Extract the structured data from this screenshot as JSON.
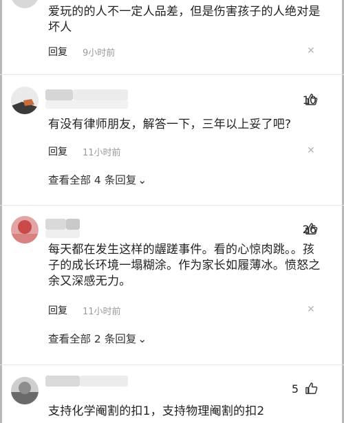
{
  "comments": [
    {
      "text_lines": [
        "爱玩的的人不一定人品差，但是伤害孩子的人绝对是",
        "坏人"
      ],
      "reply_label": "回复",
      "time": "9小时前"
    },
    {
      "likes": "10",
      "text_lines": [
        "有没有律师朋友，解答一下，三年以上妥了吧?"
      ],
      "reply_label": "回复",
      "time": "11小时前",
      "more_replies": "查看全部 4 条回复"
    },
    {
      "likes": "26",
      "text_lines": [
        "每天都在发生这样的龌蹉事件。看的心惊肉跳。。孩",
        "子的成长环境一塌糊涂。作为家长如履薄冰。愤怒之",
        "余又深感无力。"
      ],
      "reply_label": "回复",
      "time": "11小时前",
      "more_replies": "查看全部 2 条回复"
    },
    {
      "likes": "5",
      "text_lines": [
        "支持化学阉割的扣1，支持物理阉割的扣2"
      ]
    }
  ],
  "icons": {
    "close": "close-icon",
    "thumb": "thumb-up-icon",
    "chevron": "chevron-down-icon"
  }
}
